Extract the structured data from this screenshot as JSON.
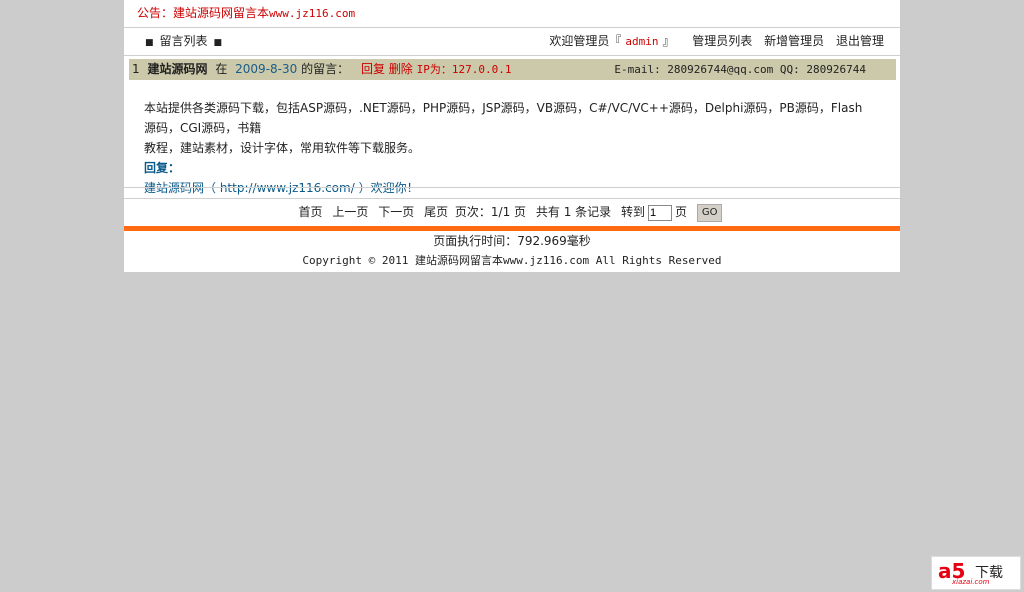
{
  "notice": {
    "label": "公告：",
    "text": "建站源码网留言本",
    "url": "www.jz116.com"
  },
  "nav": {
    "left_item": "留言列表",
    "welcome_prefix": "欢迎管理员『",
    "admin_name": "admin",
    "welcome_suffix": "』",
    "links": [
      "管理员列表",
      "新增管理员",
      "退出管理"
    ]
  },
  "message": {
    "index": "1",
    "author": "建站源码网",
    "at": "在",
    "date": "2009-8-30",
    "msg_label": "的留言：",
    "reply_action": "回复",
    "delete_action": "删除",
    "ip": "IP为：127.0.0.1",
    "email": "E-mail: 280926744@qq.com",
    "qq": "QQ: 280926744",
    "body_line1": "本站提供各类源码下载，包括ASP源码，.NET源码，PHP源码，JSP源码，VB源码，C#/VC/VC++源码，Delphi源码，PB源码，Flash源码，CGI源码，书籍",
    "body_line2": "教程，建站素材，设计字体，常用软件等下载服务。",
    "reply_label": "回复：",
    "reply_text": "建站源码网（ http://www.jz116.com/ ）欢迎你！"
  },
  "pager": {
    "first": "首页",
    "prev": "上一页",
    "next": "下一页",
    "last": "尾页",
    "page_info": "页次：1/1 页",
    "total": "共有 1 条记录",
    "goto": "转到",
    "goto_value": "1",
    "page_unit": "页",
    "go": "GO"
  },
  "footer": {
    "exec_time": "页面执行时间：792.969毫秒",
    "copyright": "Copyright © 2011 建站源码网留言本www.jz116.com All Rights Reserved"
  },
  "watermark": {
    "brand": "a5",
    "text": "下载",
    "site": "xiazai.com"
  },
  "colors": {
    "accent": "#ff6a13",
    "header_bar": "#cbc9a9",
    "alert": "#cc0000",
    "reply": "#0a5a8a"
  }
}
